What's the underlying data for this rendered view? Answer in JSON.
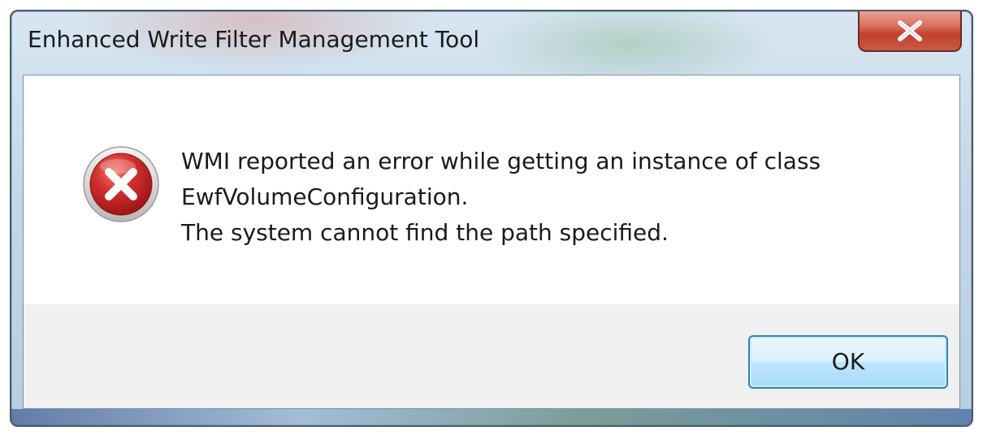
{
  "window": {
    "title": "Enhanced Write Filter Management Tool"
  },
  "message": {
    "line1": "WMI reported an error while getting an instance of class",
    "line2": "EwfVolumeConfiguration.",
    "line3": "The system cannot find the path specified."
  },
  "buttons": {
    "ok_label": "OK"
  },
  "icons": {
    "error": "error-x-icon",
    "close": "close-icon"
  },
  "colors": {
    "error_red": "#c8242b",
    "button_border": "#3c7fb1",
    "close_red": "#c1412c"
  }
}
